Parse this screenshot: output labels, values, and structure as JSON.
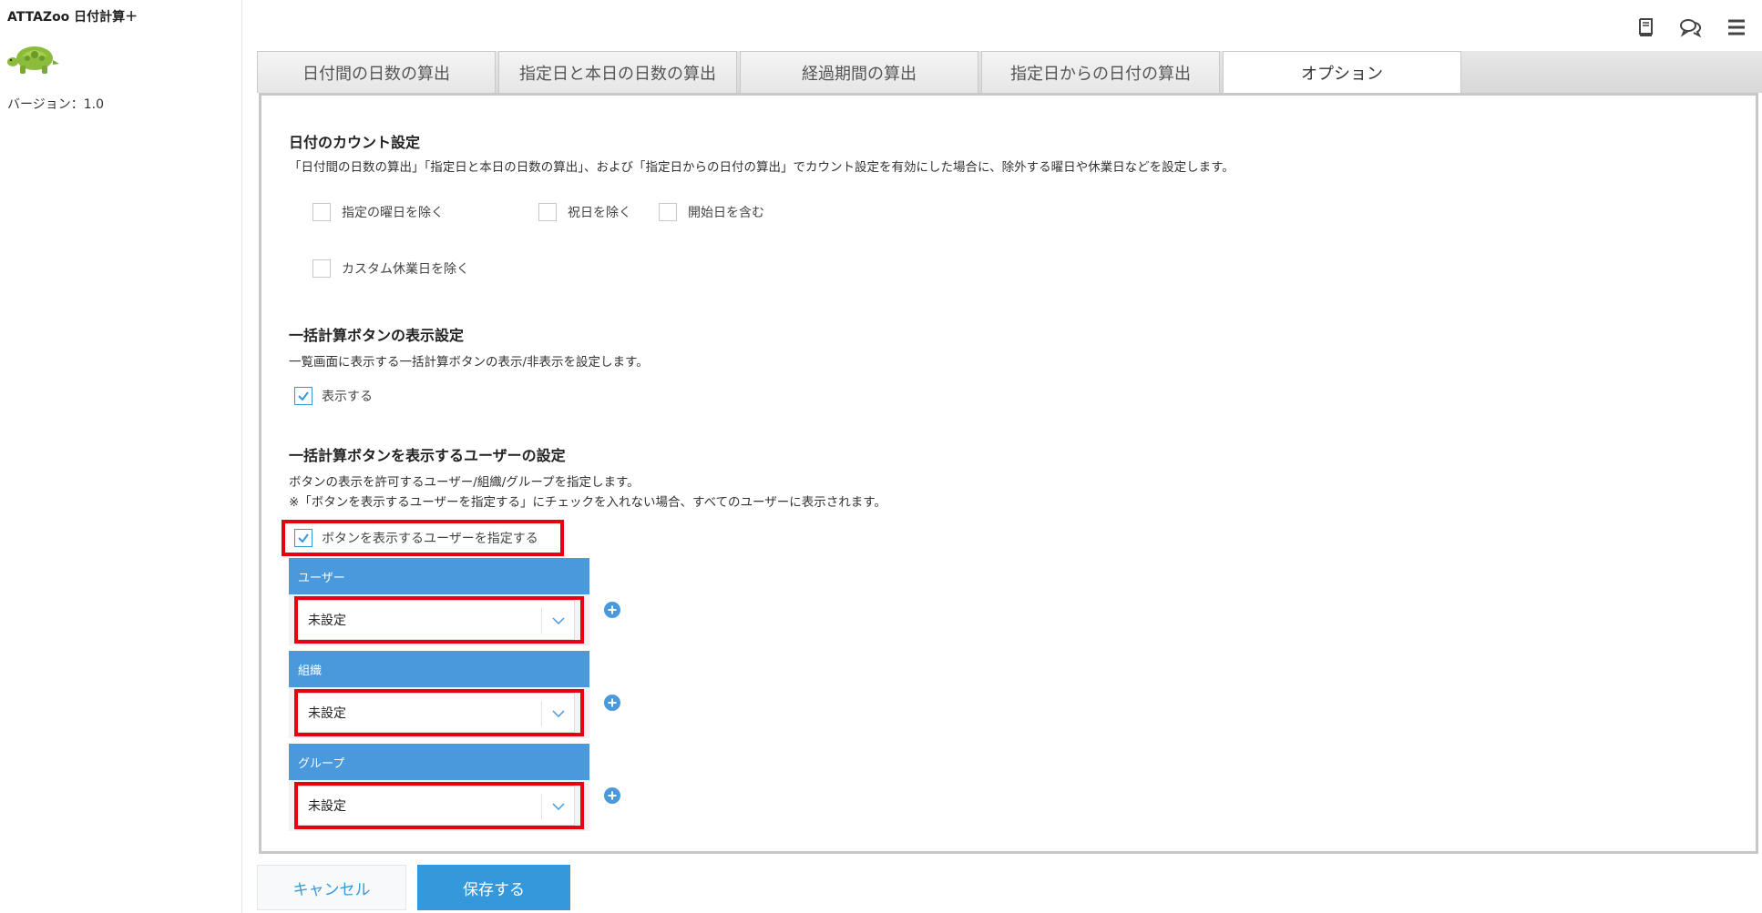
{
  "sidebar": {
    "app_title": "ATTAZoo 日付計算＋",
    "version": "バージョン：1.0",
    "logo_icon": "turtle-logo"
  },
  "header_icons": [
    "book-icon",
    "chat-icon",
    "menu-icon"
  ],
  "tabs": [
    {
      "label": "日付間の日数の算出"
    },
    {
      "label": "指定日と本日の日数の算出"
    },
    {
      "label": "経過期間の算出"
    },
    {
      "label": "指定日からの日付の算出"
    },
    {
      "label": "オプション"
    }
  ],
  "active_tab": "オプション",
  "count_settings": {
    "title": "日付のカウント設定",
    "description": "「日付間の日数の算出」「指定日と本日の日数の算出」、および「指定日からの日付の算出」でカウント設定を有効にした場合に、除外する曜日や休業日などを設定します。",
    "options": [
      {
        "label": "指定の曜日を除く",
        "checked": false
      },
      {
        "label": "祝日を除く",
        "checked": false
      },
      {
        "label": "開始日を含む",
        "checked": false
      },
      {
        "label": "カスタム休業日を除く",
        "checked": false
      }
    ]
  },
  "bulk_display": {
    "title": "一括計算ボタンの表示設定",
    "description": "一覧画面に表示する一括計算ボタンの表示/非表示を設定します。",
    "show_label": "表示する",
    "show_checked": true
  },
  "bulk_users": {
    "title": "一括計算ボタンを表示するユーザーの設定",
    "description_1": "ボタンの表示を許可するユーザー/組織/グループを指定します。",
    "description_2": "※「ボタンを表示するユーザーを指定する」にチェックを入れない場合、すべてのユーザーに表示されます。",
    "specify_label": "ボタンを表示するユーザーを指定する",
    "specify_checked": true,
    "fields": [
      {
        "header": "ユーザー",
        "value": "未設定"
      },
      {
        "header": "組織",
        "value": "未設定"
      },
      {
        "header": "グループ",
        "value": "未設定"
      }
    ]
  },
  "buttons": {
    "cancel": "キャンセル",
    "save": "保存する"
  },
  "colors": {
    "accent": "#3498db",
    "field_header": "#4a99dc",
    "highlight": "#e60012"
  }
}
